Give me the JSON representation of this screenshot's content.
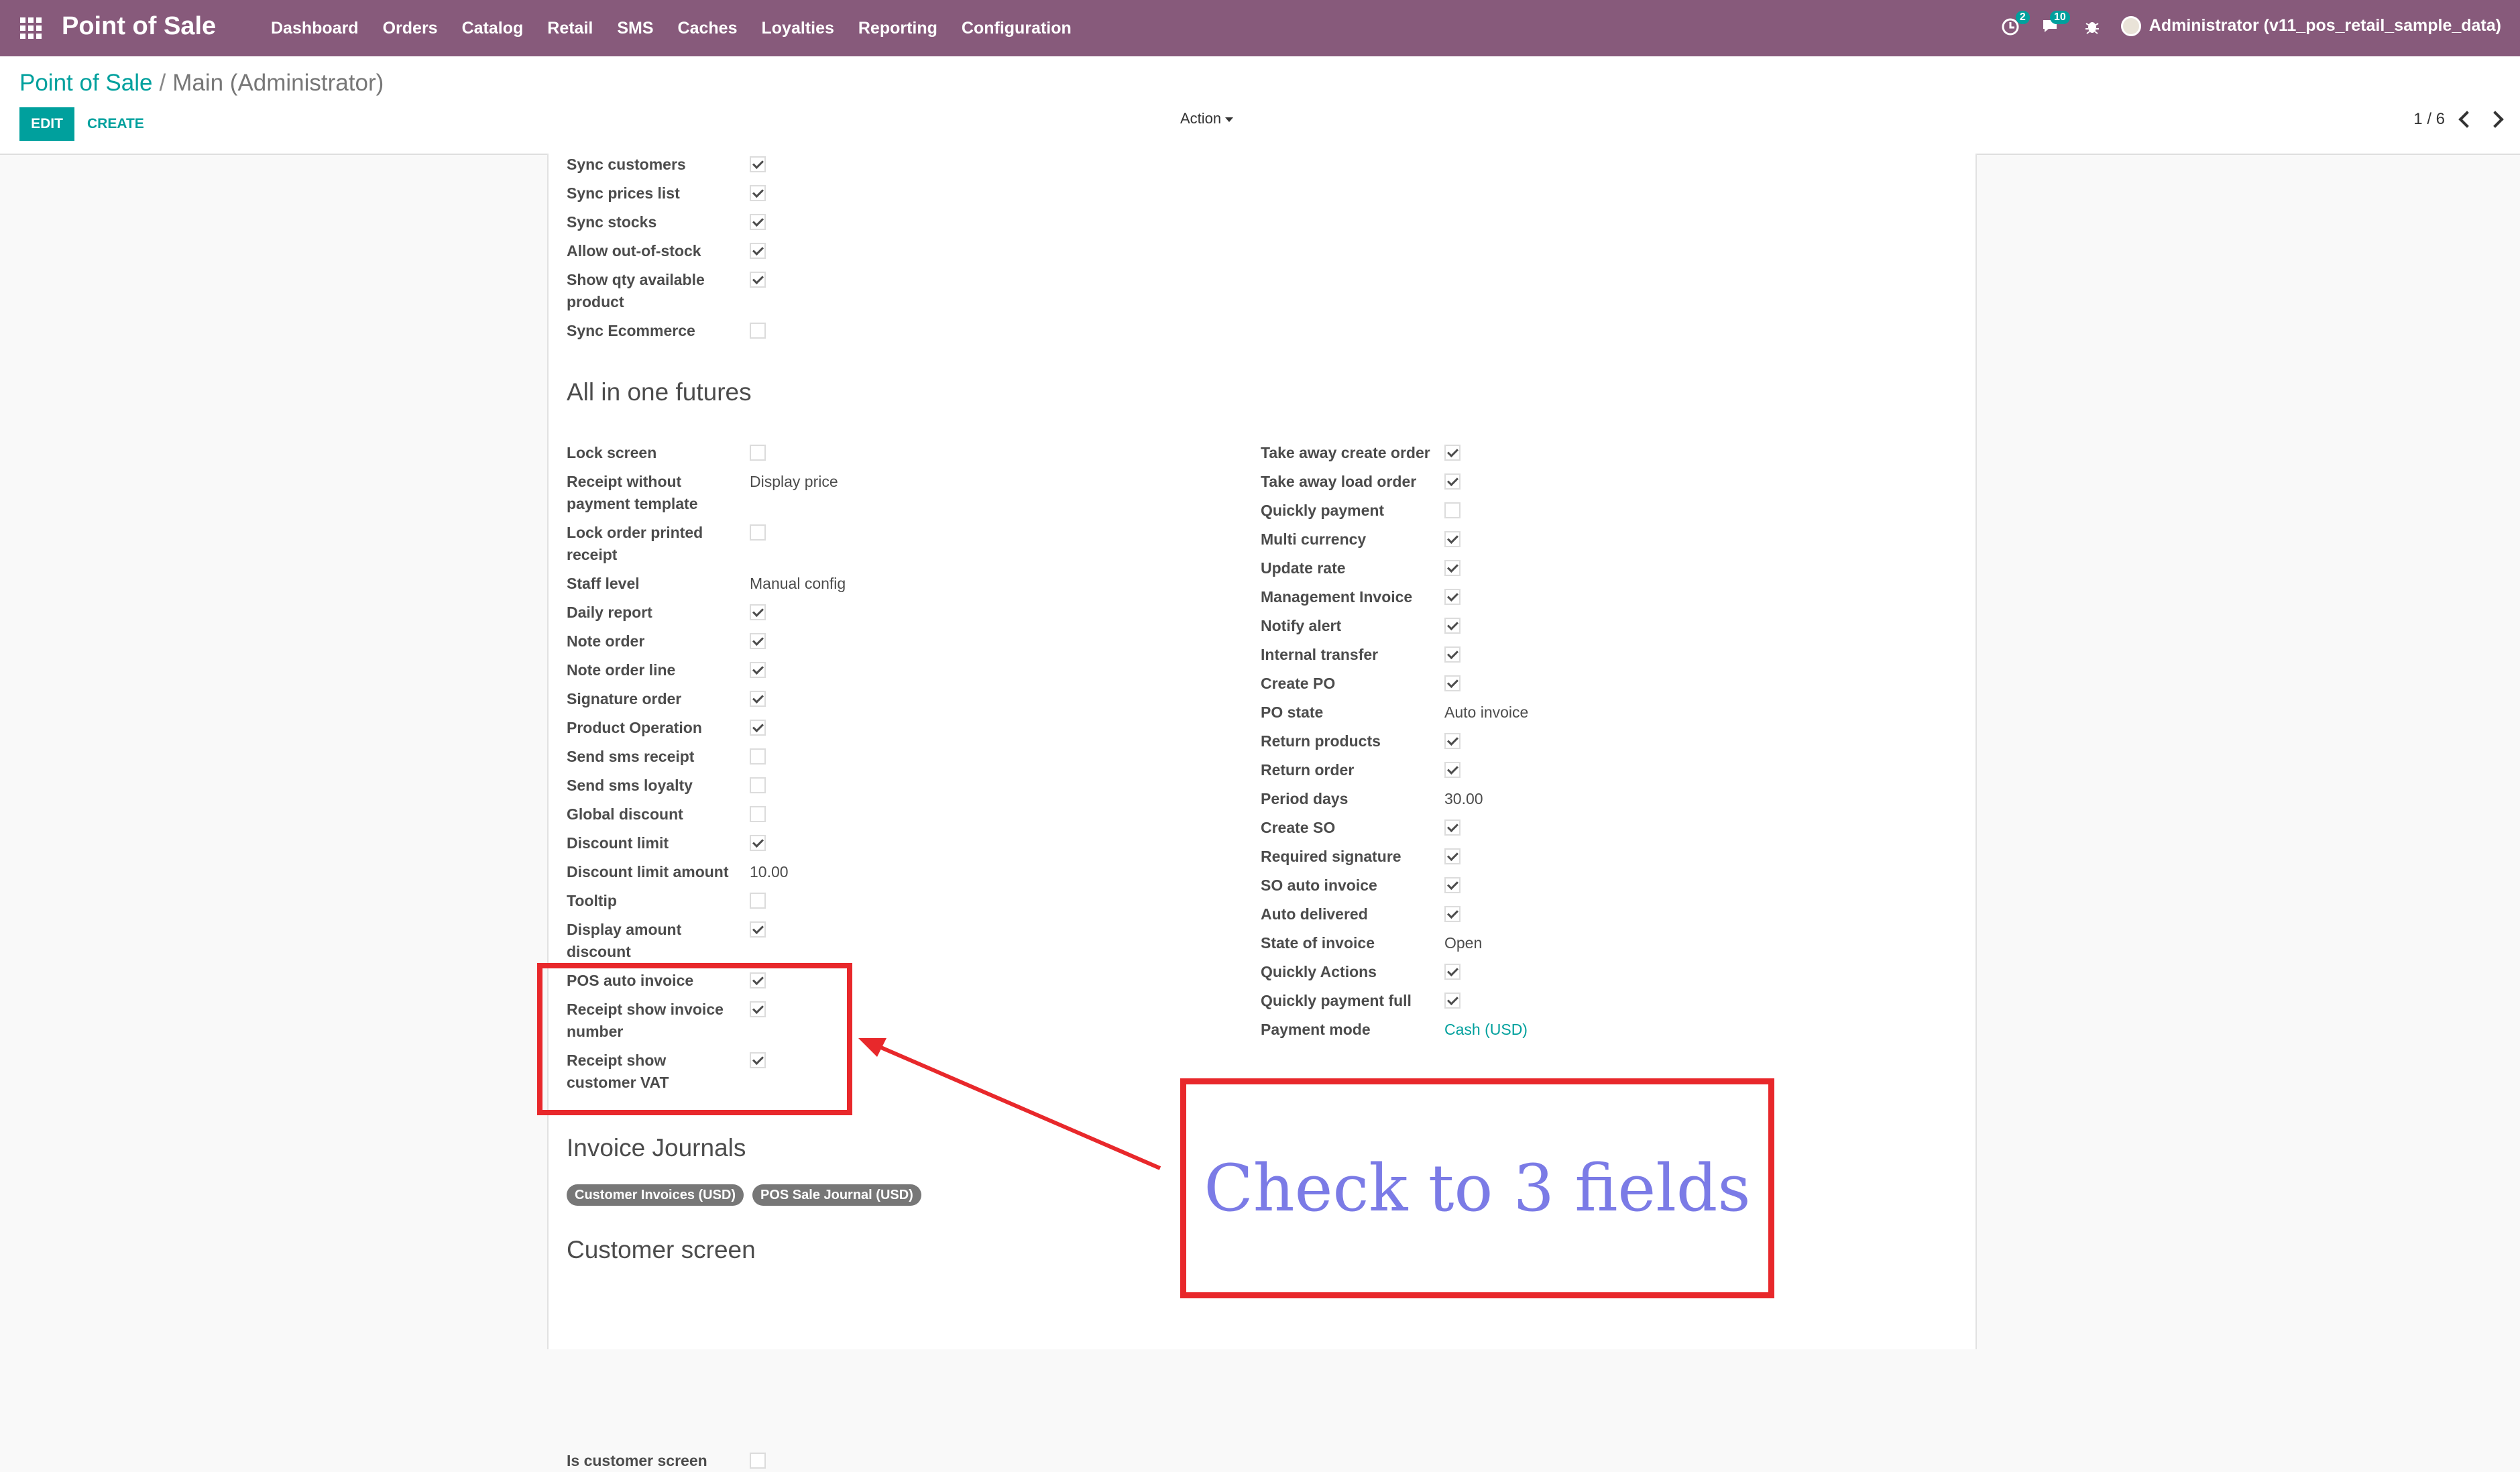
{
  "topbar": {
    "brand": "Point of Sale",
    "menu": [
      "Dashboard",
      "Orders",
      "Catalog",
      "Retail",
      "SMS",
      "Caches",
      "Loyalties",
      "Reporting",
      "Configuration"
    ],
    "badge_activity": "2",
    "badge_messages": "10",
    "user": "Administrator (v11_pos_retail_sample_data)"
  },
  "control": {
    "breadcrumb_root": "Point of Sale",
    "breadcrumb_sep": "/",
    "breadcrumb_current": "Main (Administrator)",
    "edit": "EDIT",
    "create": "CREATE",
    "action": "Action",
    "pager": "1 / 6"
  },
  "sync_fields": [
    {
      "label": "Sync customers",
      "checked": true
    },
    {
      "label": "Sync prices list",
      "checked": true
    },
    {
      "label": "Sync stocks",
      "checked": true
    },
    {
      "label": "Allow out-of-stock",
      "checked": true
    },
    {
      "label": "Show qty available",
      "label2": "product",
      "checked": true
    },
    {
      "label": "Sync Ecommerce",
      "checked": false
    }
  ],
  "section_allinone": "All in one futures",
  "left_fields": [
    {
      "label": "Lock screen",
      "checked": false
    },
    {
      "label": "Receipt without",
      "label2": "payment template",
      "value": "Display price"
    },
    {
      "label": "Lock order printed",
      "label2": "receipt",
      "checked": false
    },
    {
      "label": "Staff level",
      "value": "Manual config"
    },
    {
      "label": "Daily report",
      "checked": true
    },
    {
      "label": "Note order",
      "checked": true
    },
    {
      "label": "Note order line",
      "checked": true
    },
    {
      "label": "Signature order",
      "checked": true
    },
    {
      "label": "Product Operation",
      "checked": true
    },
    {
      "label": "Send sms receipt",
      "checked": false
    },
    {
      "label": "Send sms loyalty",
      "checked": false
    },
    {
      "label": "Global discount",
      "checked": false
    },
    {
      "label": "Discount limit",
      "checked": true
    },
    {
      "label": "Discount limit amount",
      "value": "10.00"
    },
    {
      "label": "Tooltip",
      "checked": false
    },
    {
      "label": "Display amount",
      "label2": "discount",
      "checked": true
    },
    {
      "label": "POS auto invoice",
      "checked": true
    },
    {
      "label": "Receipt show invoice",
      "label2": "number",
      "checked": true
    },
    {
      "label": "Receipt show",
      "label2": "customer VAT",
      "checked": true
    }
  ],
  "right_fields": [
    {
      "label": "Take away create order",
      "checked": true
    },
    {
      "label": "Take away load order",
      "checked": true
    },
    {
      "label": "Quickly payment",
      "checked": false
    },
    {
      "label": "Multi currency",
      "checked": true
    },
    {
      "label": "Update rate",
      "checked": true
    },
    {
      "label": "Management Invoice",
      "checked": true
    },
    {
      "label": "Notify alert",
      "checked": true
    },
    {
      "label": "Internal transfer",
      "checked": true
    },
    {
      "label": "Create PO",
      "checked": true
    },
    {
      "label": "PO state",
      "value": "Auto invoice"
    },
    {
      "label": "Return products",
      "checked": true
    },
    {
      "label": "Return order",
      "checked": true
    },
    {
      "label": "Period days",
      "value": "30.00"
    },
    {
      "label": "Create SO",
      "checked": true
    },
    {
      "label": "Required signature",
      "checked": true
    },
    {
      "label": "SO auto invoice",
      "checked": true
    },
    {
      "label": "Auto delivered",
      "checked": true
    },
    {
      "label": "State of invoice",
      "value": "Open"
    },
    {
      "label": "Quickly Actions",
      "checked": true
    },
    {
      "label": "Quickly payment full",
      "checked": true
    },
    {
      "label": "Payment mode",
      "value": "Cash (USD)",
      "link": true
    }
  ],
  "section_journals": "Invoice Journals",
  "journal_tags": [
    "Customer Invoices (USD)",
    "POS Sale Journal (USD)"
  ],
  "section_customer": "Customer screen",
  "customer_field": {
    "label": "Is customer screen",
    "checked": false
  },
  "annotation": "Check to 3 fields",
  "colors": {
    "brand": "#875a7b",
    "accent": "#00a09d",
    "highlight": "#e8282b",
    "callout_text": "#7b7be6"
  }
}
